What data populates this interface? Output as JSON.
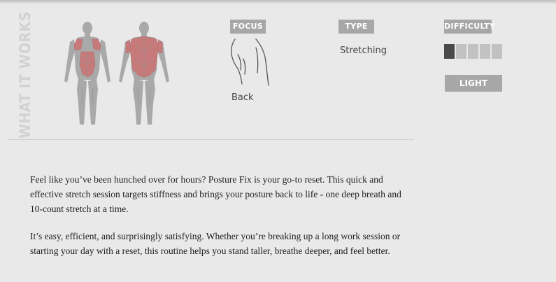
{
  "section_title": "WHAT IT WORKS",
  "colors": {
    "muscle_highlight": "#c77a7a",
    "body_base": "#a9a9a9",
    "label_bg": "#a7a7a7",
    "difficulty_active": "#4a4a4a",
    "difficulty_inactive": "#c2c2c2"
  },
  "focus": {
    "label": "FOCUS",
    "value": "Back",
    "icon": "back-torso-icon"
  },
  "type": {
    "label": "TYPE",
    "value": "Stretching"
  },
  "difficulty": {
    "label": "DIFFICULTY",
    "level": 1,
    "max": 5,
    "badge": "LIGHT"
  },
  "description": {
    "paragraph1": "Feel like you’ve been hunched over for hours? Posture Fix is your go-to reset. This quick and effective stretch session targets stiffness and brings your posture back to life - one deep breath and 10-count stretch at a time.",
    "paragraph2": "It’s easy, efficient, and surprisingly satisfying. Whether you’re breaking up a long work session or starting your day with a reset, this routine helps you stand taller, breathe deeper, and feel better."
  }
}
